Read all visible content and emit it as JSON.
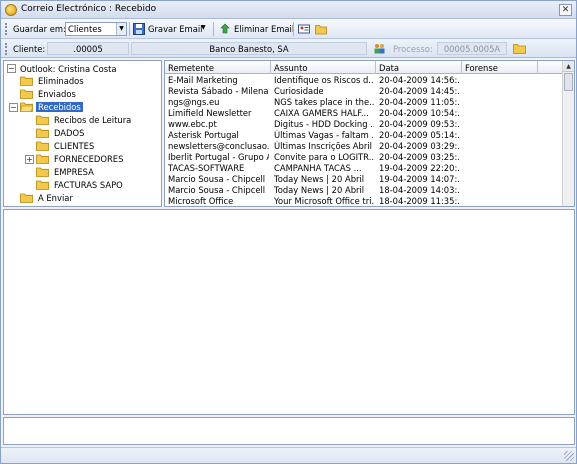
{
  "window": {
    "title": "Correio Electrónico : Recebido",
    "close_glyph": "✕"
  },
  "toolbar": {
    "save_in_label": "Guardar em:",
    "save_in_value": "Clientes",
    "save_email_label": "Gravar Email",
    "delete_email_label": "Eliminar Email"
  },
  "clientbar": {
    "client_label": "Cliente:",
    "client_code": ".00005",
    "client_name": "Banco Banesto, SA",
    "process_label": "Processo:",
    "process_value": "00005.0005A"
  },
  "tree": {
    "root": "Outlook: Cristina Costa",
    "items": [
      {
        "label": "Eliminados"
      },
      {
        "label": "Enviados"
      },
      {
        "label": "Recebidos"
      },
      {
        "label": "Recibos de Leitura"
      },
      {
        "label": "DADOS"
      },
      {
        "label": "CLIENTES"
      },
      {
        "label": "FORNECEDORES"
      },
      {
        "label": "EMPRESA"
      },
      {
        "label": "FACTURAS SAPO"
      },
      {
        "label": "A Enviar"
      }
    ]
  },
  "grid": {
    "columns": [
      "Remetente",
      "Assunto",
      "Data",
      "Forense"
    ],
    "rows": [
      [
        "E-Mail Marketing",
        "Identifique os Riscos d...",
        "20-04-2009 14:56:...",
        ""
      ],
      [
        "Revista Sábado - Milena...",
        "Curiosidade",
        "20-04-2009 14:45:...",
        ""
      ],
      [
        "ngs@ngs.eu",
        "NGS takes place in the...",
        "20-04-2009 11:05:...",
        ""
      ],
      [
        "Limifield Newsletter",
        "CAIXA GAMERS HALF...",
        "20-04-2009 10:54:...",
        ""
      ],
      [
        "www.ebc.pt",
        "Digitus - HDD Docking ...",
        "20-04-2009 09:53:...",
        ""
      ],
      [
        "Asterisk Portugal",
        "Últimas Vagas - faltam ...",
        "20-04-2009 05:14:...",
        ""
      ],
      [
        "newsletters@conclusao....",
        "Últimas Inscrições Abril ...",
        "20-04-2009 03:29:...",
        ""
      ],
      [
        "Iberlit Portugal - Grupo A...",
        "Convite para o LOGITR...",
        "20-04-2009 03:25:...",
        ""
      ],
      [
        "TACAS-SOFTWARE",
        "CAMPANHA  TACAS ...",
        "19-04-2009 22:20:...",
        ""
      ],
      [
        "Marcio Sousa - Chipcell",
        "Today News | 20 Abril",
        "19-04-2009 14:07:...",
        ""
      ],
      [
        "Marcio Sousa - Chipcell",
        "Today News | 20 Abril",
        "18-04-2009 14:03:...",
        ""
      ],
      [
        "Microsoft Office",
        "Your Microsoft Office tri...",
        "18-04-2009 11:35:...",
        ""
      ]
    ]
  },
  "icons": {
    "folder": "#f2c94c",
    "selection": "#316ac5"
  }
}
